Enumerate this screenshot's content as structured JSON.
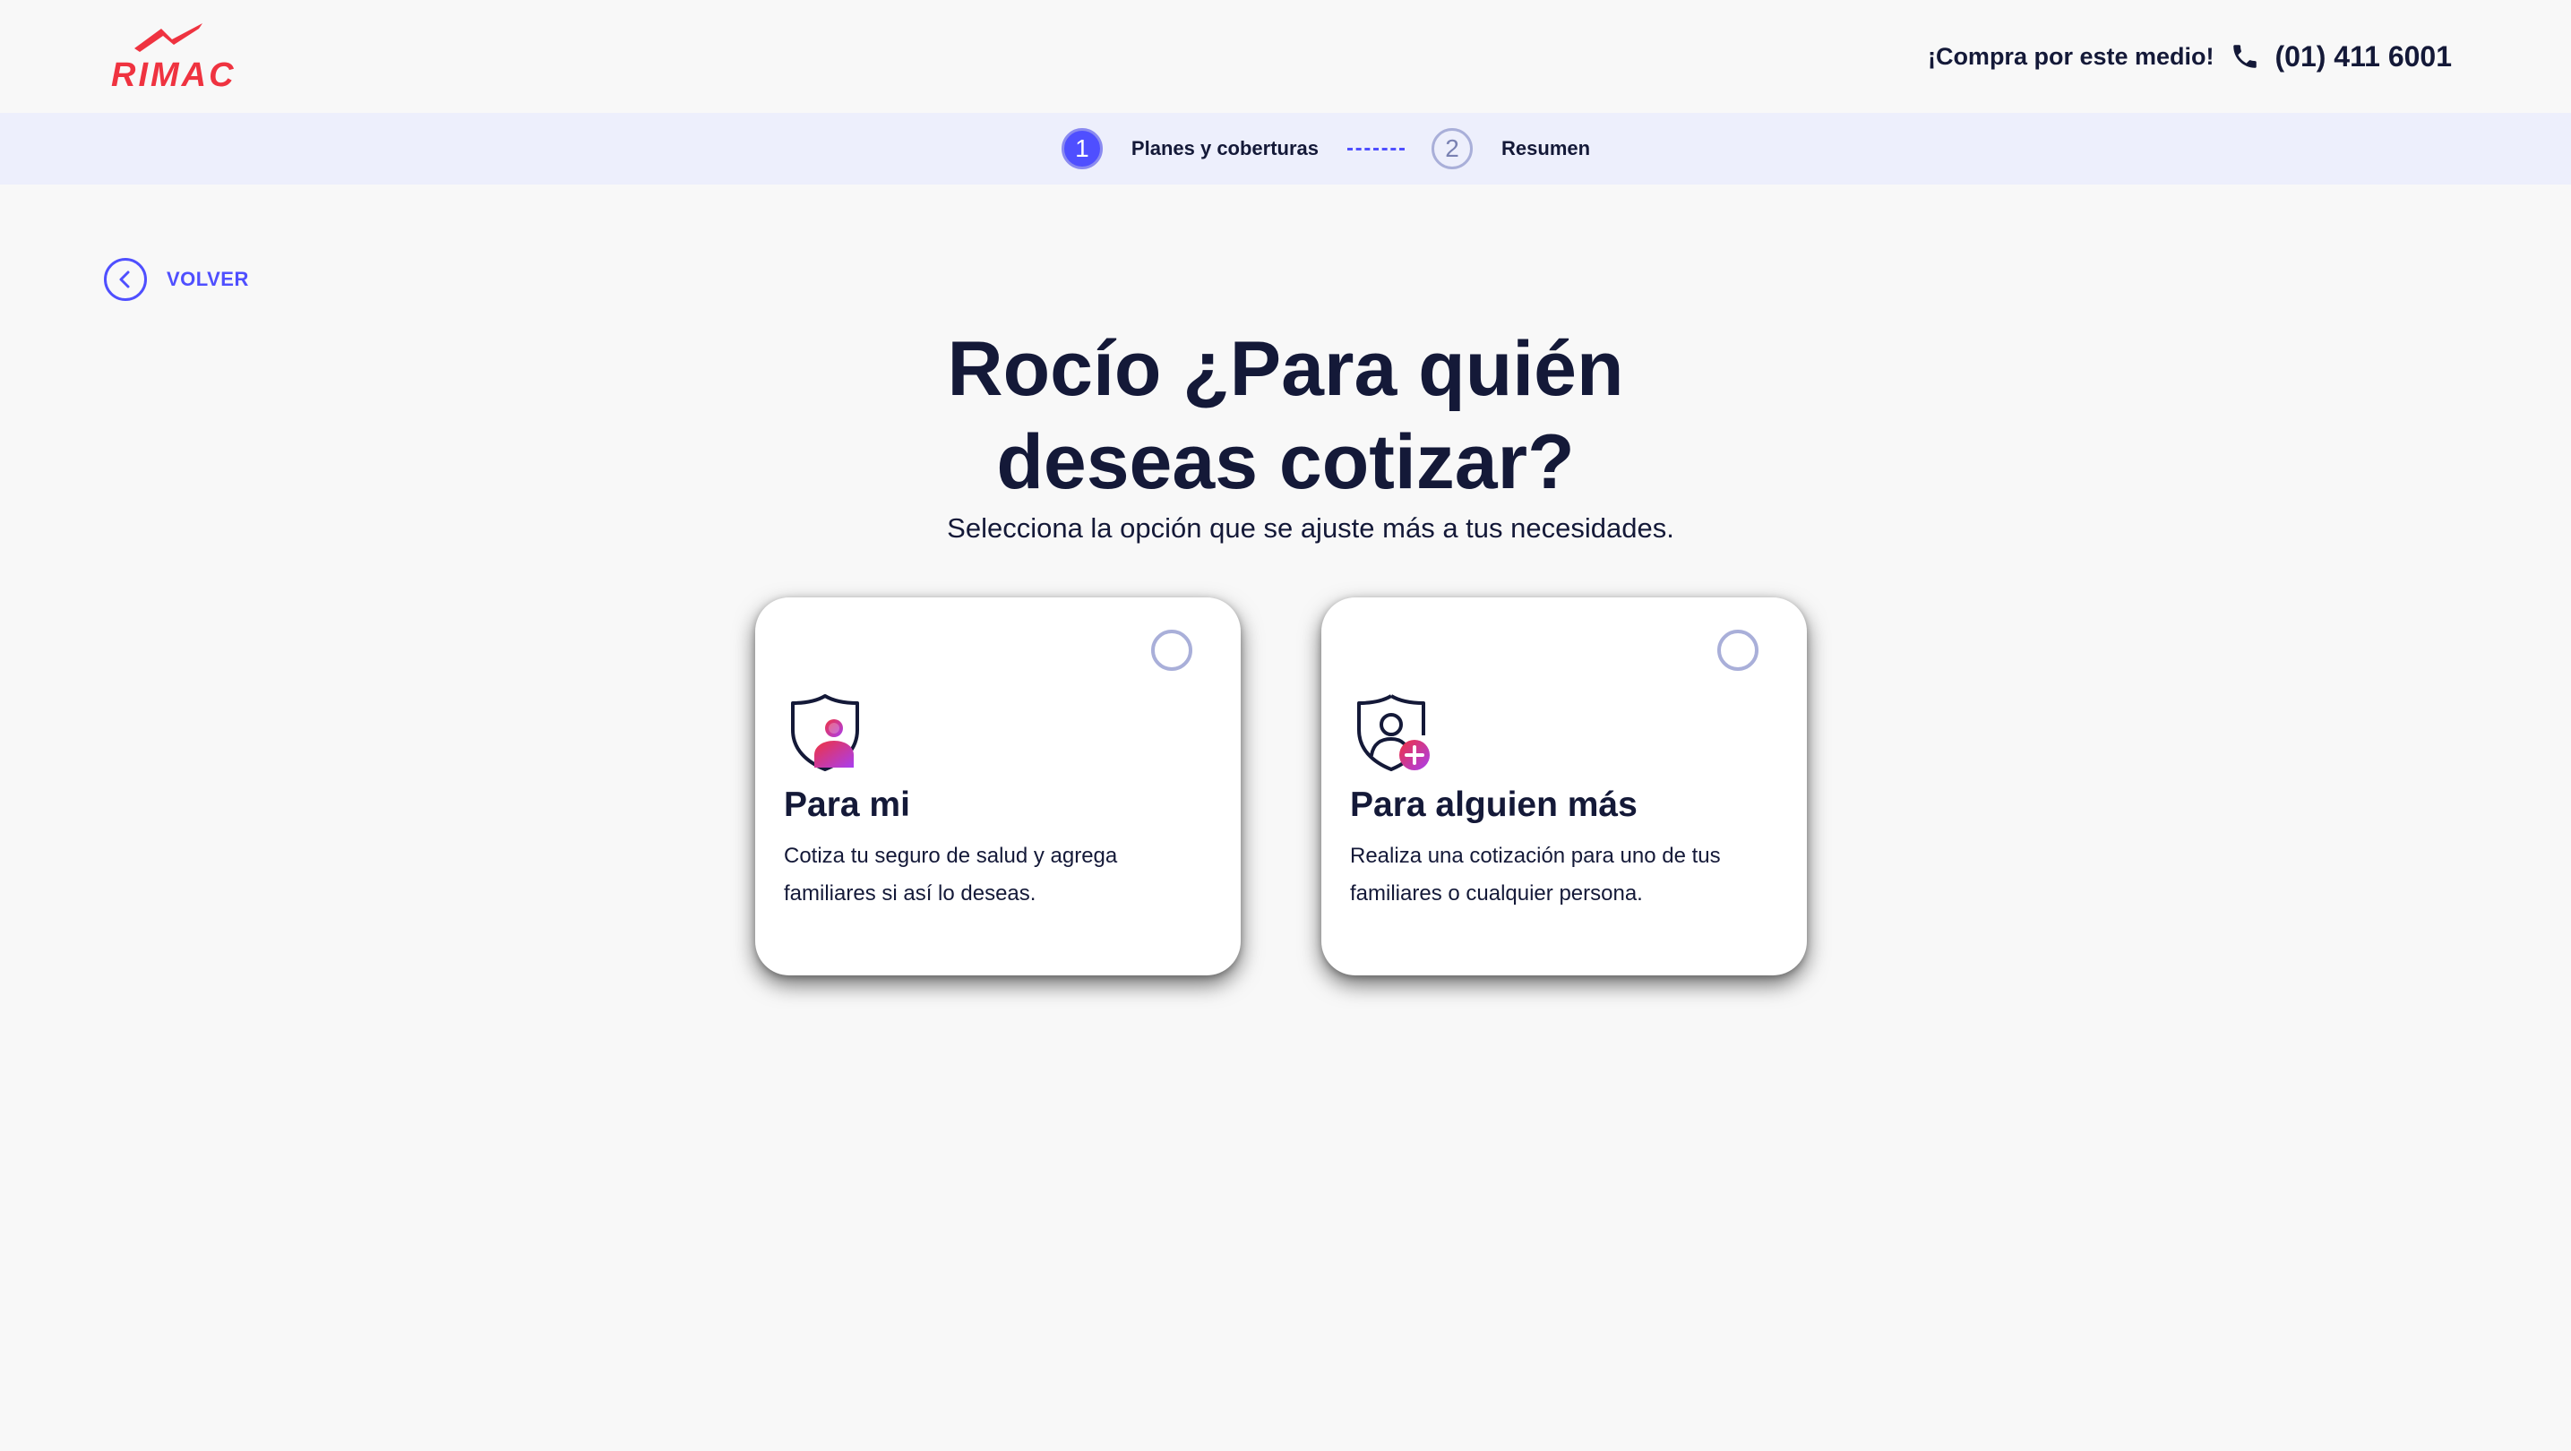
{
  "header": {
    "brand": "RIMAC",
    "contact_text": "¡Compra por este medio!",
    "phone_number": "(01) 411 6001"
  },
  "stepper": {
    "steps": [
      {
        "number": "1",
        "label": "Planes y coberturas",
        "active": true
      },
      {
        "number": "2",
        "label": "Resumen",
        "active": false
      }
    ]
  },
  "back": {
    "label": "VOLVER"
  },
  "main": {
    "title": "Rocío ¿Para quién deseas cotizar?",
    "subtitle": "Selecciona la opción que se ajuste más a tus necesidades."
  },
  "options": [
    {
      "title": "Para mi",
      "description": "Cotiza tu seguro de salud y agrega familiares si así lo deseas.",
      "icon": "shield-person-icon",
      "selected": false
    },
    {
      "title": "Para alguien más",
      "description": "Realiza una cotización para uno de tus familiares o cualquier persona.",
      "icon": "shield-add-person-icon",
      "selected": false
    }
  ],
  "colors": {
    "brand_red": "#ef3340",
    "accent_blue": "#4f4fff",
    "text_dark": "#141938",
    "stepper_bg": "#edeffc",
    "page_bg": "#f8f8f8"
  }
}
